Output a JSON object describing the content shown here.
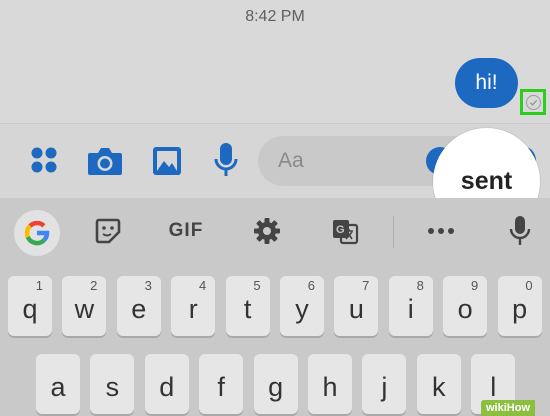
{
  "status_bar": {
    "time": "8:42 PM"
  },
  "message": {
    "text": "hi!",
    "status_icon": "sent-check-icon"
  },
  "callout": {
    "label": "sent"
  },
  "composer": {
    "placeholder": "Aa",
    "icons": [
      "apps-icon",
      "camera-icon",
      "gallery-icon",
      "microphone-icon"
    ]
  },
  "suggestion_bar": {
    "gif_label": "GIF",
    "icons": [
      "google-icon",
      "sticker-icon",
      "gif-icon",
      "settings-icon",
      "translate-icon",
      "more-icon",
      "voice-icon"
    ]
  },
  "keyboard": {
    "row1": [
      {
        "key": "q",
        "num": "1"
      },
      {
        "key": "w",
        "num": "2"
      },
      {
        "key": "e",
        "num": "3"
      },
      {
        "key": "r",
        "num": "4"
      },
      {
        "key": "t",
        "num": "5"
      },
      {
        "key": "y",
        "num": "6"
      },
      {
        "key": "u",
        "num": "7"
      },
      {
        "key": "i",
        "num": "8"
      },
      {
        "key": "o",
        "num": "9"
      },
      {
        "key": "p",
        "num": "0"
      }
    ],
    "row2": [
      "a",
      "s",
      "d",
      "f",
      "g",
      "h",
      "j",
      "k",
      "l"
    ]
  },
  "watermark": "wikiHow",
  "colors": {
    "bubble": "#1d69c2",
    "icons": "#1d69c2",
    "highlight": "#2ecc1c"
  }
}
